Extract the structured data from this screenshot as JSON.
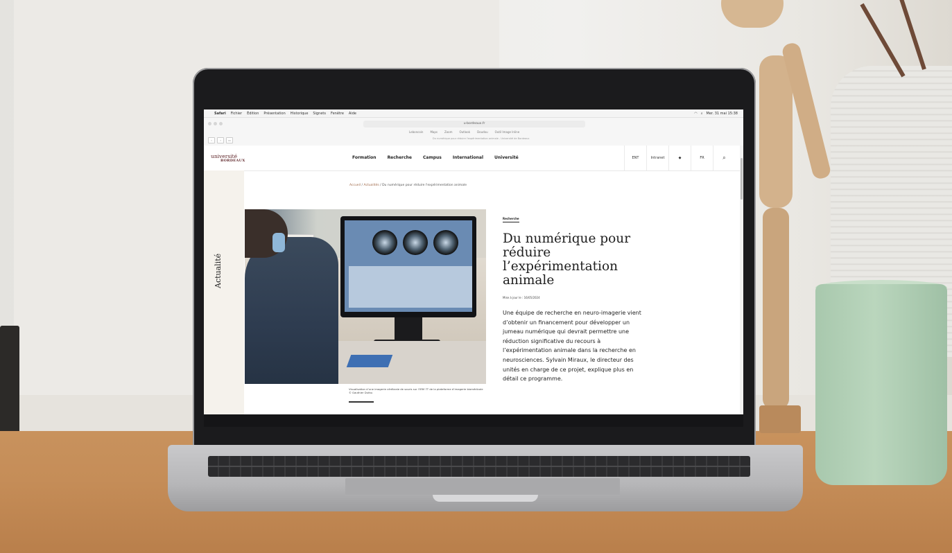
{
  "macos_menubar": {
    "apple": "",
    "items": [
      "Safari",
      "Fichier",
      "Édition",
      "Présentation",
      "Historique",
      "Signets",
      "Fenêtre",
      "Aide"
    ],
    "clock": "Mer. 31 mai 15:38"
  },
  "browser": {
    "url": "u-bordeaux.fr",
    "bookmarks": [
      "Leboncoin",
      "Maps",
      "Zoom",
      "Outlook",
      "Doudou",
      "Outil Image Inline"
    ],
    "tab_title": "Du numérique pour réduire l'expérimentation animale - Université de Bordeaux"
  },
  "site": {
    "logo_line1": "université",
    "logo_line2": "BORDEAUX",
    "nav": [
      "Formation",
      "Recherche",
      "Campus",
      "International",
      "Université"
    ],
    "tools": {
      "ent": "ENT",
      "intranet": "Intranet",
      "accessibility_icon": "accessibility-icon",
      "lang": "FR",
      "search_icon": "search-icon"
    },
    "sidebar_label": "Actualité"
  },
  "breadcrumb": {
    "home": "Accueil",
    "section": "Actualités",
    "current": "Du numérique pour réduire l'expérimentation animale"
  },
  "article": {
    "category": "Recherche",
    "title": "Du numérique pour réduire l’expérimentation animale",
    "updated": "Mise à jour le : 16/05/2024",
    "lede": "Une équipe de recherche en neuro-imagerie vient d’obtenir un financement pour développer un jumeau numérique qui devrait permettre une réduction significative du recours à l’expérimentation animale dans la recherche en neurosciences. Sylvain Miraux, le directeur des unités en charge de ce projet, explique plus en détail ce programme.",
    "photo_caption": "Visualisation d’une imagerie cérébrale de souris sur l’IRM 7T de la plateforme d’imagerie biomédicale © Gauthier Dufau"
  }
}
